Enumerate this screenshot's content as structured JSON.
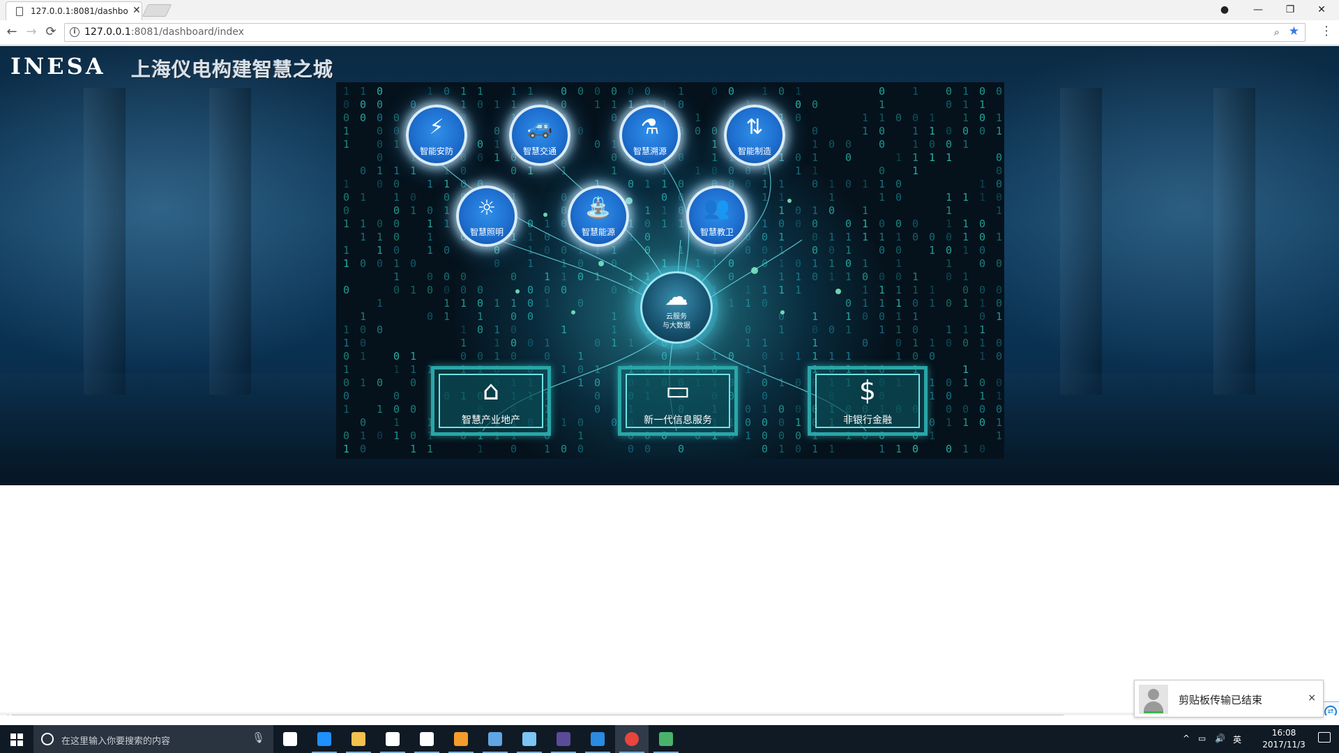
{
  "browser": {
    "tab_title": "127.0.0.1:8081/dashbo",
    "tab_close": "✕",
    "url_host": "127.0.0.1",
    "url_rest": ":8081/dashboard/index",
    "window_controls": {
      "account": "●",
      "minimize": "—",
      "restore": "❐",
      "close": "✕"
    },
    "nav": {
      "back": "←",
      "forward": "→",
      "reload": "⟳"
    },
    "menu": "⋮"
  },
  "header": {
    "logo": "INESA",
    "slogan": "上海仪电构建智慧之城"
  },
  "services_top": [
    {
      "label": "智能安防",
      "icon": "⚡"
    },
    {
      "label": "智慧交通",
      "icon": "🚙"
    },
    {
      "label": "智慧溯源",
      "icon": "⚗"
    },
    {
      "label": "智能制造",
      "icon": "⇅"
    }
  ],
  "services_mid": [
    {
      "label": "智慧照明",
      "icon": "☼"
    },
    {
      "label": "智慧能源",
      "icon": "⛲"
    },
    {
      "label": "智慧教卫",
      "icon": "👥"
    }
  ],
  "cloud": {
    "label_line1": "云服务",
    "label_line2": "与大数据",
    "icon": "☁"
  },
  "business": [
    {
      "label": "智慧产业地产",
      "icon": "⌂"
    },
    {
      "label": "新一代信息服务",
      "icon": "▭"
    },
    {
      "label": "非银行金融",
      "icon": "$"
    }
  ],
  "toast": {
    "message": "剪贴板传输已结束",
    "close": "×"
  },
  "taskbar": {
    "search_placeholder": "在这里输入你要搜索的内容",
    "tray_lang": "英",
    "time": "16:08",
    "date": "2017/11/3",
    "apps": [
      {
        "name": "task-view",
        "color": "#ffffff"
      },
      {
        "name": "edge",
        "color": "#1e90ff"
      },
      {
        "name": "file-explorer",
        "color": "#f2c14e"
      },
      {
        "name": "store",
        "color": "#ffffff"
      },
      {
        "name": "mail",
        "color": "#ffffff"
      },
      {
        "name": "sublime-text",
        "color": "#f59d2a"
      },
      {
        "name": "office-app",
        "color": "#5fa6e3"
      },
      {
        "name": "notepad",
        "color": "#7cc4f4"
      },
      {
        "name": "eclipse",
        "color": "#5b4a9a"
      },
      {
        "name": "vscode",
        "color": "#2b8ae2"
      },
      {
        "name": "chrome",
        "color": "#e8453c"
      },
      {
        "name": "git-kraken",
        "color": "#49b36b"
      }
    ]
  }
}
